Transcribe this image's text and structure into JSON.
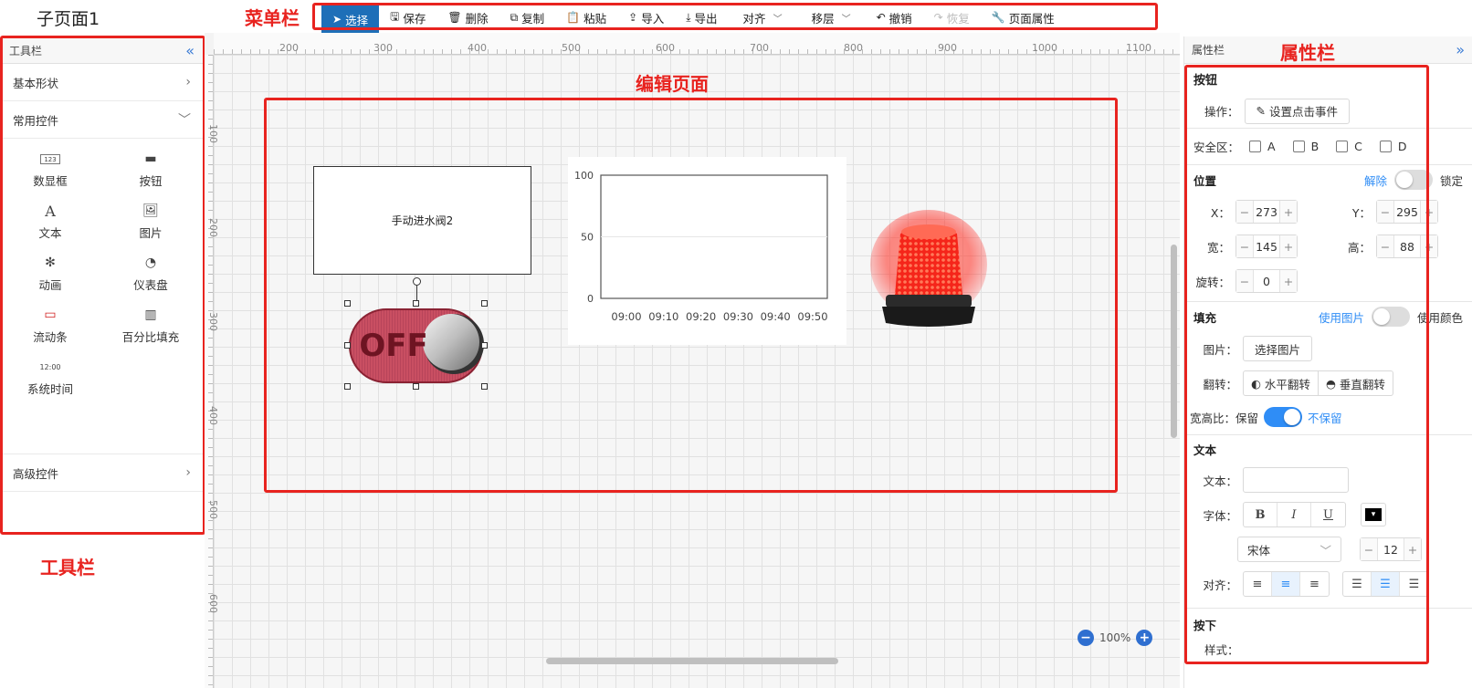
{
  "page_title": "子页面1",
  "annotations": {
    "menubar": "菜单栏",
    "property_bar": "属性栏",
    "edit_page": "编辑页面",
    "toolbar": "工具栏"
  },
  "menubar": {
    "items": [
      {
        "label": "选择",
        "icon": "pointer-icon",
        "glyph": "➤",
        "state": "active"
      },
      {
        "label": "保存",
        "icon": "save-icon",
        "glyph": "🖫",
        "state": "normal"
      },
      {
        "label": "删除",
        "icon": "trash-icon",
        "glyph": "🗑",
        "state": "normal"
      },
      {
        "label": "复制",
        "icon": "copy-icon",
        "glyph": "⧉",
        "state": "normal"
      },
      {
        "label": "粘贴",
        "icon": "paste-icon",
        "glyph": "📋",
        "state": "normal"
      },
      {
        "label": "导入",
        "icon": "upload-icon",
        "glyph": "⇪",
        "state": "normal"
      },
      {
        "label": "导出",
        "icon": "download-icon",
        "glyph": "⤓",
        "state": "normal"
      },
      {
        "label": "对齐",
        "icon": "chevron-down-icon",
        "glyph": "﹀",
        "state": "dropdown"
      },
      {
        "label": "移层",
        "icon": "chevron-down-icon",
        "glyph": "﹀",
        "state": "dropdown"
      },
      {
        "label": "撤销",
        "icon": "undo-icon",
        "glyph": "↶",
        "state": "normal"
      },
      {
        "label": "恢复",
        "icon": "redo-icon",
        "glyph": "↷",
        "state": "disabled"
      },
      {
        "label": "页面属性",
        "icon": "wrench-icon",
        "glyph": "🔧",
        "state": "normal"
      }
    ]
  },
  "toolbar": {
    "title": "工具栏",
    "collapse_icon": "double-chevron-left-icon",
    "categories": {
      "basic": "基本形状",
      "common": "常用控件",
      "advanced": "高级控件"
    },
    "widgets": [
      {
        "label": "数显框",
        "icon": "numeric-display-icon",
        "glyph": "123"
      },
      {
        "label": "按钮",
        "icon": "button-icon",
        "glyph": "▬"
      },
      {
        "label": "文本",
        "icon": "text-icon",
        "glyph": "A"
      },
      {
        "label": "图片",
        "icon": "image-icon",
        "glyph": "🖼"
      },
      {
        "label": "动画",
        "icon": "animation-icon",
        "glyph": "✻"
      },
      {
        "label": "仪表盘",
        "icon": "gauge-icon",
        "glyph": "◔"
      },
      {
        "label": "流动条",
        "icon": "flow-bar-icon",
        "glyph": "▭"
      },
      {
        "label": "百分比填充",
        "icon": "percent-fill-icon",
        "glyph": "▥"
      },
      {
        "label": "系统时间",
        "icon": "clock-icon",
        "glyph": "12:00"
      }
    ]
  },
  "canvas": {
    "ruler_top": [
      "200",
      "300",
      "400",
      "500",
      "600",
      "700",
      "800",
      "900",
      "1000",
      "1100"
    ],
    "ruler_left": [
      "100",
      "200",
      "300",
      "400",
      "500",
      "600"
    ],
    "textbox_label": "手动进水阀2",
    "button_text": "OFF",
    "zoom": "100%",
    "chart_data": {
      "type": "line",
      "x": [
        "09:00",
        "09:10",
        "09:20",
        "09:30",
        "09:40",
        "09:50"
      ],
      "series": [],
      "ylim": [
        0,
        100
      ],
      "yticks": [
        "0",
        "50",
        "100"
      ],
      "grid": true
    }
  },
  "props": {
    "title": "属性栏",
    "element_title": "按钮",
    "operation_label": "操作：",
    "set_click_event": "设置点击事件",
    "safe_zone_label": "安全区：",
    "safe_zone_options": [
      "A",
      "B",
      "C",
      "D"
    ],
    "position": {
      "title": "位置",
      "unlock": "解除",
      "lock": "锁定",
      "x_label": "X：",
      "x": "273",
      "y_label": "Y：",
      "y": "295",
      "w_label": "宽：",
      "w": "145",
      "h_label": "高：",
      "h": "88",
      "rot_label": "旋转：",
      "rot": "0"
    },
    "fill": {
      "title": "填充",
      "use_image": "使用图片",
      "use_color": "使用颜色",
      "image_label": "图片：",
      "choose_image": "选择图片",
      "flip_label": "翻转：",
      "flip_h": "水平翻转",
      "flip_v": "垂直翻转",
      "aspect_label": "宽高比：保留",
      "aspect_no": "不保留"
    },
    "text": {
      "title": "文本",
      "text_label": "文本：",
      "text_value": "",
      "font_label": "字体：",
      "bold": "B",
      "italic": "I",
      "underline": "U",
      "font_name": "宋体",
      "font_size": "12",
      "align_label": "对齐："
    },
    "press": {
      "title": "按下",
      "style_label": "样式："
    }
  }
}
